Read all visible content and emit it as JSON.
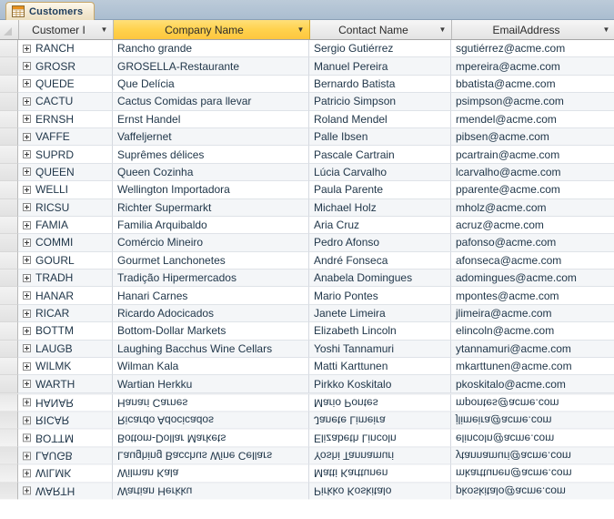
{
  "window": {
    "tab": {
      "label": "Customers",
      "icon": "table-icon"
    }
  },
  "grid": {
    "columns": [
      {
        "key": "customer_id",
        "label": "Customer I",
        "selected": false,
        "caret": "▼"
      },
      {
        "key": "company_name",
        "label": "Company Name",
        "selected": true,
        "caret": "▼"
      },
      {
        "key": "contact_name",
        "label": "Contact Name",
        "selected": false,
        "caret": "▼"
      },
      {
        "key": "email_address",
        "label": "EmailAddress",
        "selected": false,
        "caret": "▼"
      }
    ],
    "rows": [
      {
        "customer_id": "RANCH",
        "company_name": "Rancho grande",
        "contact_name": "Sergio Gutiérrez",
        "email_address": "sgutiérrez@acme.com"
      },
      {
        "customer_id": "GROSR",
        "company_name": "GROSELLA-Restaurante",
        "contact_name": "Manuel Pereira",
        "email_address": "mpereira@acme.com"
      },
      {
        "customer_id": "QUEDE",
        "company_name": "Que Delícia",
        "contact_name": "Bernardo Batista",
        "email_address": "bbatista@acme.com"
      },
      {
        "customer_id": "CACTU",
        "company_name": "Cactus Comidas para llevar",
        "contact_name": "Patricio Simpson",
        "email_address": "psimpson@acme.com"
      },
      {
        "customer_id": "ERNSH",
        "company_name": "Ernst Handel",
        "contact_name": "Roland Mendel",
        "email_address": "rmendel@acme.com"
      },
      {
        "customer_id": "VAFFE",
        "company_name": "Vaffeljernet",
        "contact_name": "Palle Ibsen",
        "email_address": "pibsen@acme.com"
      },
      {
        "customer_id": "SUPRD",
        "company_name": "Suprêmes délices",
        "contact_name": "Pascale Cartrain",
        "email_address": "pcartrain@acme.com"
      },
      {
        "customer_id": "QUEEN",
        "company_name": "Queen Cozinha",
        "contact_name": "Lúcia Carvalho",
        "email_address": "lcarvalho@acme.com"
      },
      {
        "customer_id": "WELLI",
        "company_name": "Wellington Importadora",
        "contact_name": "Paula Parente",
        "email_address": "pparente@acme.com"
      },
      {
        "customer_id": "RICSU",
        "company_name": "Richter Supermarkt",
        "contact_name": "Michael Holz",
        "email_address": "mholz@acme.com"
      },
      {
        "customer_id": "FAMIA",
        "company_name": "Familia Arquibaldo",
        "contact_name": "Aria Cruz",
        "email_address": "acruz@acme.com"
      },
      {
        "customer_id": "COMMI",
        "company_name": "Comércio Mineiro",
        "contact_name": "Pedro Afonso",
        "email_address": "pafonso@acme.com"
      },
      {
        "customer_id": "GOURL",
        "company_name": "Gourmet Lanchonetes",
        "contact_name": "André Fonseca",
        "email_address": "afonseca@acme.com"
      },
      {
        "customer_id": "TRADH",
        "company_name": "Tradição Hipermercados",
        "contact_name": "Anabela Domingues",
        "email_address": "adomingues@acme.com"
      },
      {
        "customer_id": "HANAR",
        "company_name": "Hanari Carnes",
        "contact_name": "Mario Pontes",
        "email_address": "mpontes@acme.com"
      },
      {
        "customer_id": "RICAR",
        "company_name": "Ricardo Adocicados",
        "contact_name": "Janete Limeira",
        "email_address": "jlimeira@acme.com"
      },
      {
        "customer_id": "BOTTM",
        "company_name": "Bottom-Dollar Markets",
        "contact_name": "Elizabeth Lincoln",
        "email_address": "elincoln@acme.com"
      },
      {
        "customer_id": "LAUGB",
        "company_name": "Laughing Bacchus Wine Cellars",
        "contact_name": "Yoshi Tannamuri",
        "email_address": "ytannamuri@acme.com"
      },
      {
        "customer_id": "WILMK",
        "company_name": "Wilman Kala",
        "contact_name": "Matti Karttunen",
        "email_address": "mkarttunen@acme.com"
      },
      {
        "customer_id": "WARTH",
        "company_name": "Wartian Herkku",
        "contact_name": "Pirkko Koskitalo",
        "email_address": "pkoskitalo@acme.com"
      }
    ],
    "reflected_rows": [
      {
        "customer_id": "WARTH",
        "company_name": "Wartian Herkku",
        "contact_name": "Pirkko Koskitalo",
        "email_address": "pkoskitalo@acme.com"
      },
      {
        "customer_id": "WILMK",
        "company_name": "Wilman Kala",
        "contact_name": "Matti Karttunen",
        "email_address": "mkarttunen@acme.com"
      },
      {
        "customer_id": "LAUGB",
        "company_name": "Laughing Bacchus Wine Cellars",
        "contact_name": "Yoshi Tannamuri",
        "email_address": "ytannamuri@acme.com"
      },
      {
        "customer_id": "BOTTM",
        "company_name": "Bottom-Dollar Markets",
        "contact_name": "Elizabeth Lincoln",
        "email_address": "elincoln@acme.com"
      },
      {
        "customer_id": "RICAR",
        "company_name": "Ricardo Adocicados",
        "contact_name": "Janete Limeira",
        "email_address": "jlimeira@acme.com"
      },
      {
        "customer_id": "HANAR",
        "company_name": "Hanari Carnes",
        "contact_name": "Mario Pontes",
        "email_address": "mpontes@acme.com"
      }
    ]
  },
  "colors": {
    "selected_header": "#FFD24D",
    "tab_strip": "#B4C5D6",
    "tab_active": "#F3E9D2",
    "text": "#21374A"
  }
}
